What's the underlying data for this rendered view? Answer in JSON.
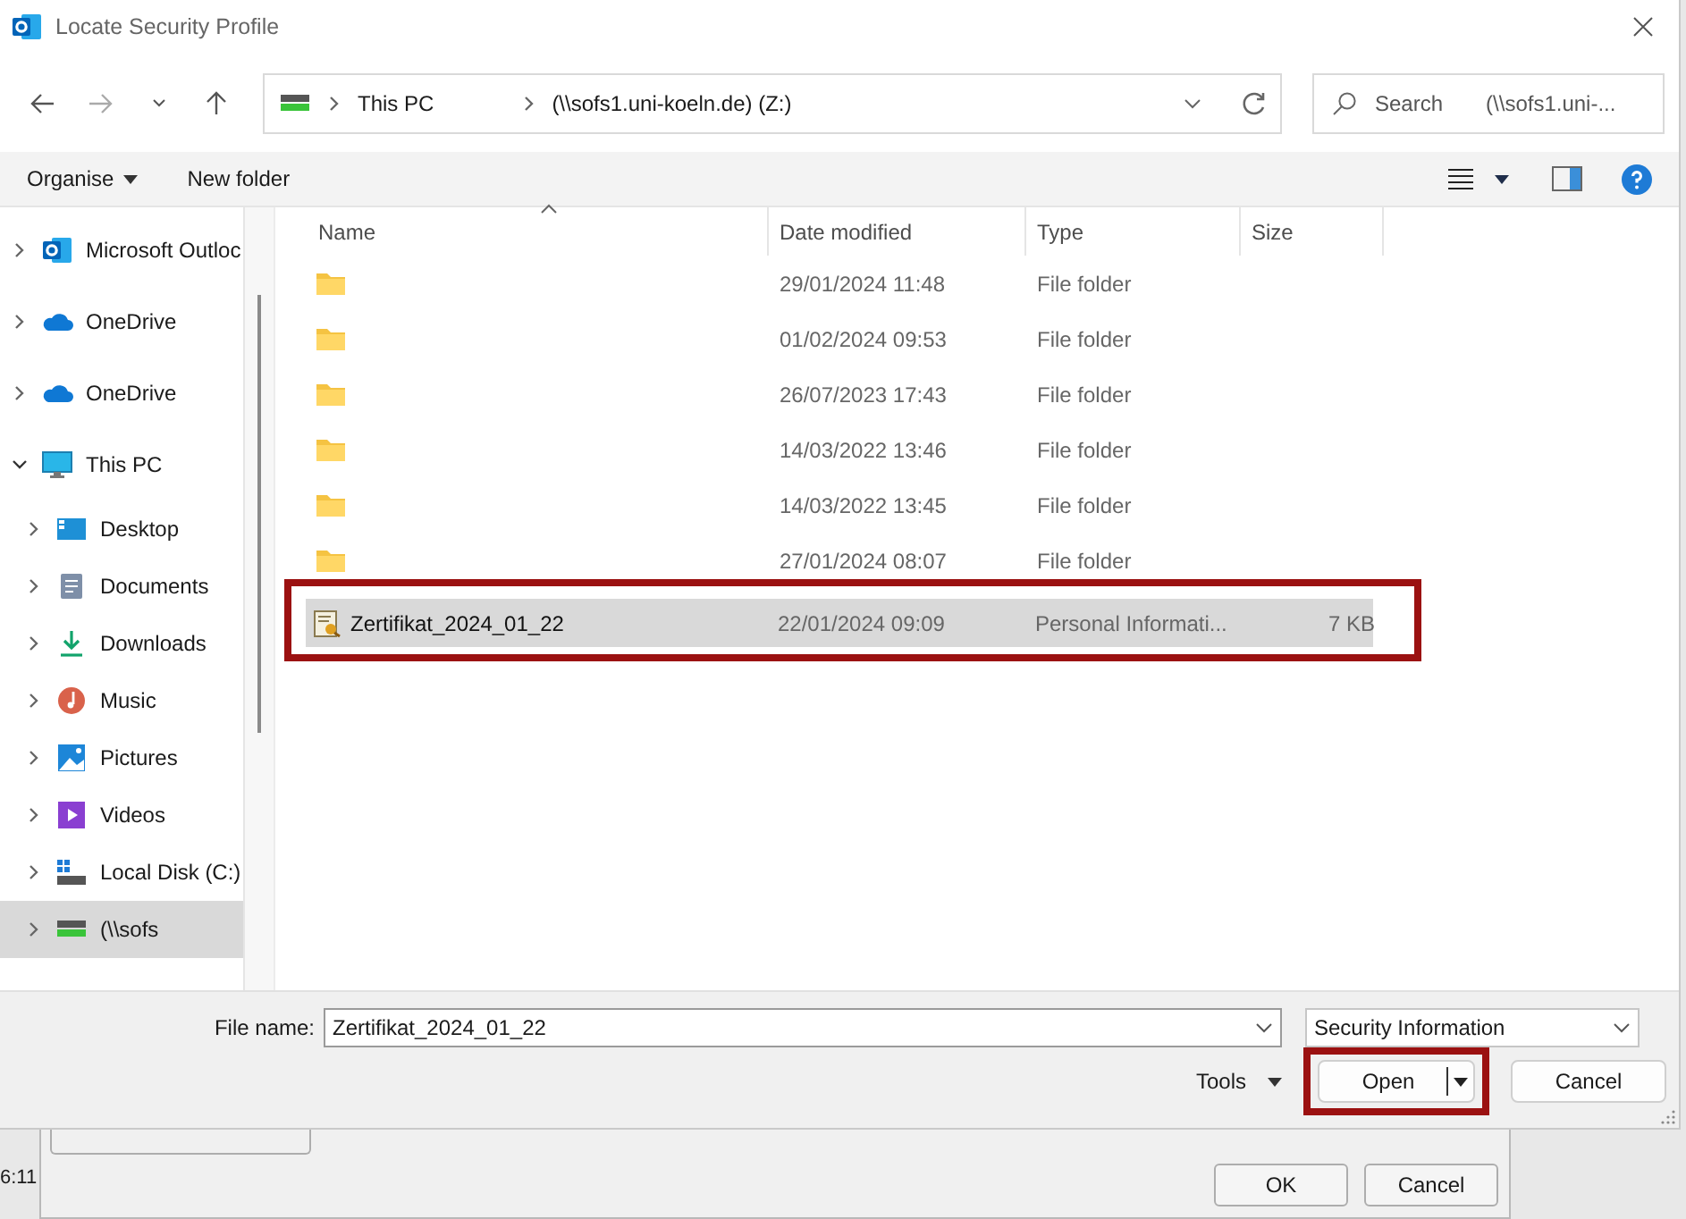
{
  "window": {
    "title": "Locate Security Profile"
  },
  "address_bar": {
    "segments": [
      "This PC",
      "(\\\\sofs1.uni-koeln.de) (Z:)"
    ]
  },
  "search": {
    "placeholder": "Search",
    "scope": "(\\\\sofs1.uni-..."
  },
  "toolbar": {
    "organise": "Organise",
    "new_folder": "New folder"
  },
  "sidebar": {
    "items": [
      {
        "label": "Microsoft Outloc",
        "kind": "outlook",
        "expanded": false,
        "selected": false
      },
      {
        "label": "OneDrive",
        "kind": "cloud",
        "expanded": false,
        "selected": false
      },
      {
        "label": "OneDrive",
        "kind": "cloud",
        "expanded": false,
        "selected": false
      },
      {
        "label": "This PC",
        "kind": "monitor",
        "expanded": true,
        "selected": false,
        "children": [
          {
            "label": "Desktop",
            "kind": "desktop",
            "expanded": false,
            "selected": false
          },
          {
            "label": "Documents",
            "kind": "document",
            "expanded": false,
            "selected": false
          },
          {
            "label": "Downloads",
            "kind": "download",
            "expanded": false,
            "selected": false
          },
          {
            "label": "Music",
            "kind": "music",
            "expanded": false,
            "selected": false
          },
          {
            "label": "Pictures",
            "kind": "picture",
            "expanded": false,
            "selected": false
          },
          {
            "label": "Videos",
            "kind": "video",
            "expanded": false,
            "selected": false
          },
          {
            "label": "Local Disk (C:)",
            "kind": "disk",
            "expanded": false,
            "selected": false
          },
          {
            "label": "(\\\\sofs",
            "kind": "netdrive",
            "expanded": false,
            "selected": true
          }
        ]
      }
    ]
  },
  "file_list": {
    "columns": [
      {
        "label": "Name",
        "sorted": true
      },
      {
        "label": "Date modified",
        "sorted": false
      },
      {
        "label": "Type",
        "sorted": false
      },
      {
        "label": "Size",
        "sorted": false
      }
    ],
    "rows": [
      {
        "kind": "folder",
        "date": "29/01/2024 11:48",
        "type": "File folder",
        "selected": false,
        "highlighted": false
      },
      {
        "kind": "folder",
        "date": "01/02/2024 09:53",
        "type": "File folder",
        "selected": false,
        "highlighted": false
      },
      {
        "kind": "folder",
        "date": "26/07/2023 17:43",
        "type": "File folder",
        "selected": false,
        "highlighted": false
      },
      {
        "kind": "folder",
        "date": "14/03/2022 13:46",
        "type": "File folder",
        "selected": false,
        "highlighted": false
      },
      {
        "kind": "folder",
        "date": "14/03/2022 13:45",
        "type": "File folder",
        "selected": false,
        "highlighted": false
      },
      {
        "kind": "folder",
        "date": "27/01/2024 08:07",
        "type": "File folder",
        "selected": false,
        "highlighted": false
      },
      {
        "kind": "certificate",
        "name": "Zertifikat_2024_01_22",
        "date": "22/01/2024 09:09",
        "type": "Personal Informati...",
        "size": "7 KB",
        "selected": true,
        "highlighted": true
      }
    ]
  },
  "footer": {
    "file_name_label": "File name:",
    "file_name": "Zertifikat_2024_01_22",
    "file_type": "Security Information",
    "tools": "Tools",
    "open": "Open",
    "cancel": "Cancel",
    "open_highlighted": true
  },
  "background_dialog": {
    "time": "6:11",
    "ok": "OK",
    "cancel": "Cancel"
  }
}
